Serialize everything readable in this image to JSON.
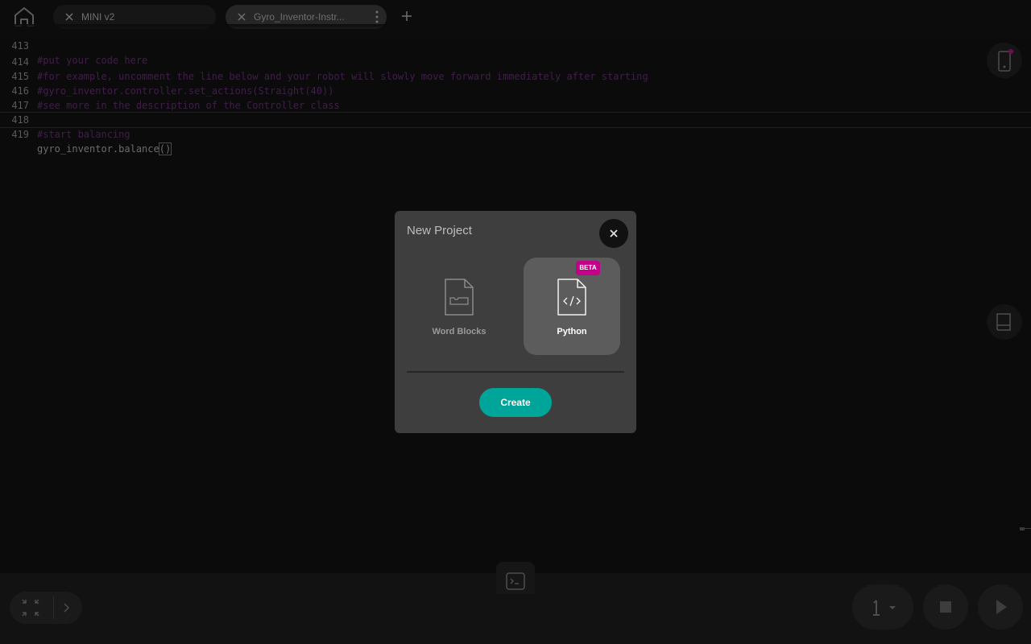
{
  "tabs": [
    {
      "label": "MINI v2"
    },
    {
      "label": "Gyro_Inventor-Instr..."
    }
  ],
  "editor": {
    "lines": [
      {
        "num": "413",
        "text": "#put your code here",
        "kind": "comment"
      },
      {
        "num": "414",
        "text": "#for example, uncomment the line below and your robot will slowly move forward immediately after starting",
        "kind": "comment"
      },
      {
        "num": "415",
        "text": "#gyro_inventor.controller.set_actions(Straight(40))",
        "kind": "comment"
      },
      {
        "num": "416",
        "text": "#see more in the description of the Controller class",
        "kind": "comment"
      },
      {
        "num": "417",
        "text": "",
        "kind": "normal"
      },
      {
        "num": "418",
        "text": "#start balancing",
        "kind": "comment"
      },
      {
        "num": "419",
        "text": "gyro_inventor.balance",
        "kind": "normal",
        "suffix": "()"
      }
    ]
  },
  "modal": {
    "title": "New Project",
    "options": [
      {
        "label": "Word Blocks",
        "icon": "word-blocks-file-icon",
        "selected": false
      },
      {
        "label": "Python",
        "icon": "python-file-icon",
        "badge": "BETA",
        "selected": true
      }
    ],
    "create_label": "Create"
  },
  "colors": {
    "accent": "#00a59a",
    "beta_badge": "#c4008a",
    "modal_bg": "#3e3e3e"
  }
}
